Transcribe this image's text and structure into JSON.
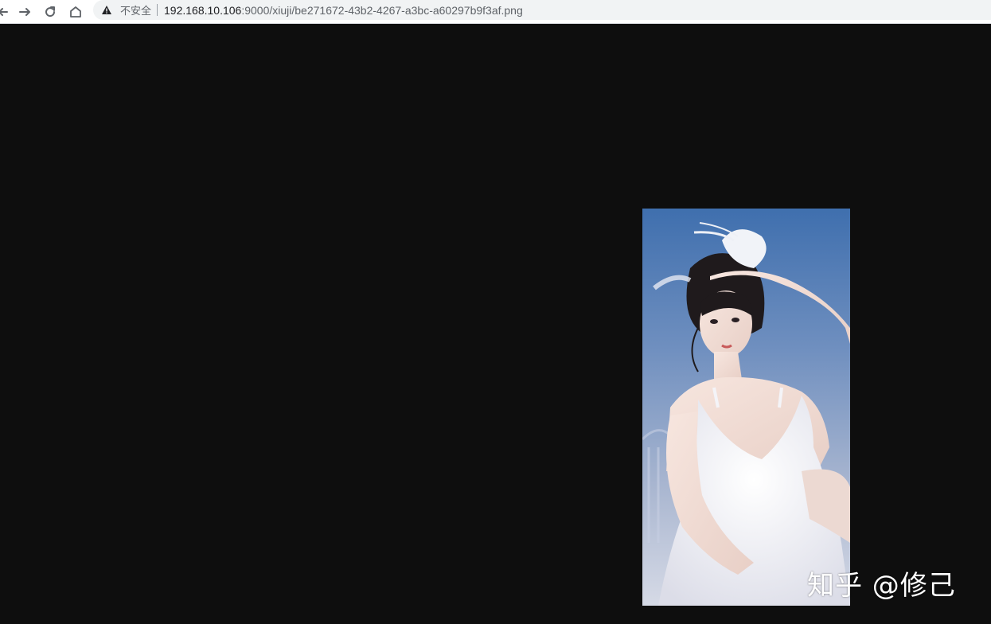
{
  "toolbar": {
    "buttons": [
      "back",
      "forward",
      "reload",
      "home"
    ],
    "security_label": "不安全",
    "url_host": "192.168.10.106",
    "url_rest": ":9000/xiuji/be271672-43b2-4267-a3bc-a60297b9f3af.png"
  },
  "viewer": {
    "background": "#0e0e0e",
    "watermark": "知乎 @修己"
  },
  "colors": {
    "sky": "#4d7db5",
    "dress": "#f4f4f8",
    "hair": "#1f1a1c",
    "skin": "#f0dcd4"
  }
}
